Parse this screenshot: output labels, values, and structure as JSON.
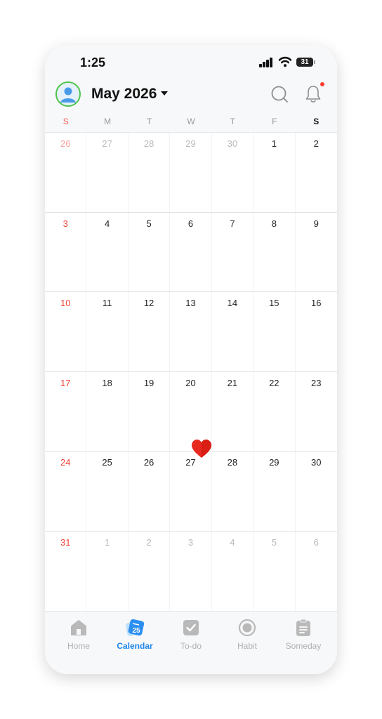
{
  "status": {
    "time": "1:25",
    "battery": "31"
  },
  "header": {
    "month_title": "May 2026"
  },
  "weekdays": [
    "S",
    "M",
    "T",
    "W",
    "T",
    "F",
    "S"
  ],
  "weeks": [
    [
      "26",
      "27",
      "28",
      "29",
      "30",
      "1",
      "2"
    ],
    [
      "3",
      "4",
      "5",
      "6",
      "7",
      "8",
      "9"
    ],
    [
      "10",
      "11",
      "12",
      "13",
      "14",
      "15",
      "16"
    ],
    [
      "17",
      "18",
      "19",
      "20",
      "21",
      "22",
      "23"
    ],
    [
      "24",
      "25",
      "26",
      "27",
      "28",
      "29",
      "30"
    ],
    [
      "31",
      "1",
      "2",
      "3",
      "4",
      "5",
      "6"
    ]
  ],
  "tabs": [
    {
      "label": "Home",
      "icon": "home-icon"
    },
    {
      "label": "Calendar",
      "icon": "calendar-icon",
      "badge": "25"
    },
    {
      "label": "To-do",
      "icon": "checkbox-icon"
    },
    {
      "label": "Habit",
      "icon": "habit-icon"
    },
    {
      "label": "Someday",
      "icon": "clipboard-icon"
    }
  ],
  "colors": {
    "accent": "#1e86e8",
    "sunday": "#f04336",
    "heart": "#e8291f",
    "avatar_ring": "#4cc44a"
  }
}
